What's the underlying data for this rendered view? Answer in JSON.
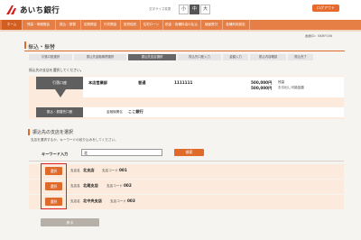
{
  "header": {
    "bank_name": "あいち銀行",
    "font_size_label": "文字サイズ変更",
    "font_sizes": [
      "小",
      "中",
      "大"
    ],
    "logout_label": "ログアウト"
  },
  "nav": {
    "items": [
      "ホーム",
      "残高・明細照会",
      "振込・振替",
      "定期預金",
      "外貨預金",
      "投資信託",
      "住宅ローン",
      "税金・各種料金の払込",
      "諸届受付",
      "各種利用設定"
    ]
  },
  "screen_id": "画面ID：BKRF006",
  "page_title": "振込・振替",
  "steps": [
    "引落口座選択",
    "振込先金融機関選択",
    "振込先支店選択",
    "振込先口座入力",
    "金額入力",
    "振込内容確認",
    "振込完了"
  ],
  "current_step": 2,
  "instruction": "振込先の支店を選択してください。",
  "from": {
    "label": "引落口座",
    "branch": "本店営業部",
    "type": "普通",
    "number": "1111111",
    "amount1": "500,000円",
    "amount1_desc": "残高",
    "amount2": "500,000円",
    "amount2_desc": "お引出し可能金額"
  },
  "to": {
    "label": "振込・振替先口座",
    "bank_label": "金融機関名",
    "bank_name": "ここ銀行"
  },
  "branch_select": {
    "title": "振込先の支店を選択",
    "instruction": "支店を選択するか、キーワードの絞り込みをしてください。",
    "keyword_label": "キーワード入力",
    "keyword_value": "北",
    "search_label": "検索",
    "select_label": "選択",
    "branch_name_label": "支店名",
    "branch_code_label": "支店コード",
    "branches": [
      {
        "name": "北支店",
        "code": "001"
      },
      {
        "name": "北尾支店",
        "code": "002"
      },
      {
        "name": "北中央支店",
        "code": "003"
      }
    ]
  },
  "back_label": "戻る"
}
